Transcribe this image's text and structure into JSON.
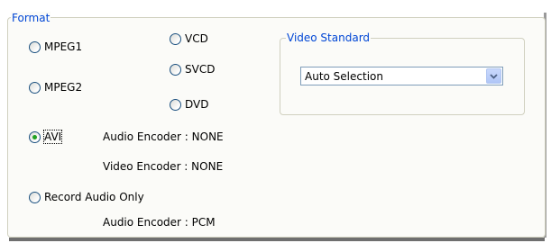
{
  "format": {
    "legend": "Format",
    "options": {
      "mpeg1": "MPEG1",
      "vcd": "VCD",
      "svcd": "SVCD",
      "mpeg2": "MPEG2",
      "dvd": "DVD",
      "avi": "AVI",
      "record_audio_only": "Record Audio Only"
    },
    "selected": "AVI",
    "avi_audio_encoder": "Audio Encoder : NONE",
    "avi_video_encoder": "Video Encoder : NONE",
    "record_audio_encoder": "Audio Encoder : PCM"
  },
  "video_standard": {
    "legend": "Video Standard",
    "selected_value": "Auto Selection"
  },
  "colors": {
    "legend_text": "#0046d5",
    "group_border": "#d0d0bf",
    "radio_checked_dot": "#21a121",
    "dropdown_border": "#7f9db9"
  },
  "icons": {
    "dropdown": "chevron-down-icon",
    "radio": "radio-button-icon"
  }
}
